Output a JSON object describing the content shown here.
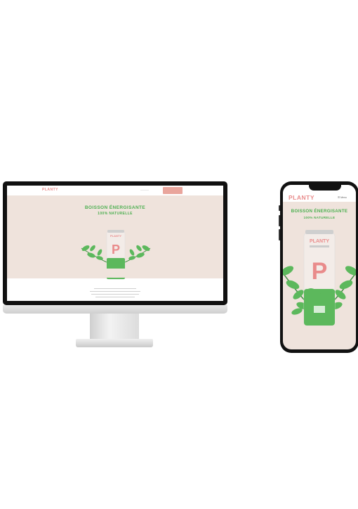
{
  "desktop": {
    "nav": {
      "logo": "PLANTY",
      "link": "————",
      "cta": ""
    },
    "hero": {
      "headline": "BOISSON ÉNERGISANTE",
      "subheadline": "100% NATURELLE"
    }
  },
  "mobile": {
    "nav": {
      "logo": "PLANTY",
      "menu": "☰ Menu"
    },
    "hero": {
      "headline": "BOISSON ÉNERGISANTE",
      "subheadline": "100% NATURELLE"
    }
  },
  "colors": {
    "brand_pink": "#e98b8b",
    "brand_green": "#4caf50",
    "hero_bg": "#efe3dc",
    "can_green": "#5cb85c"
  },
  "icons": {
    "menu": "hamburger-icon",
    "leaf": "leaf-icon"
  }
}
